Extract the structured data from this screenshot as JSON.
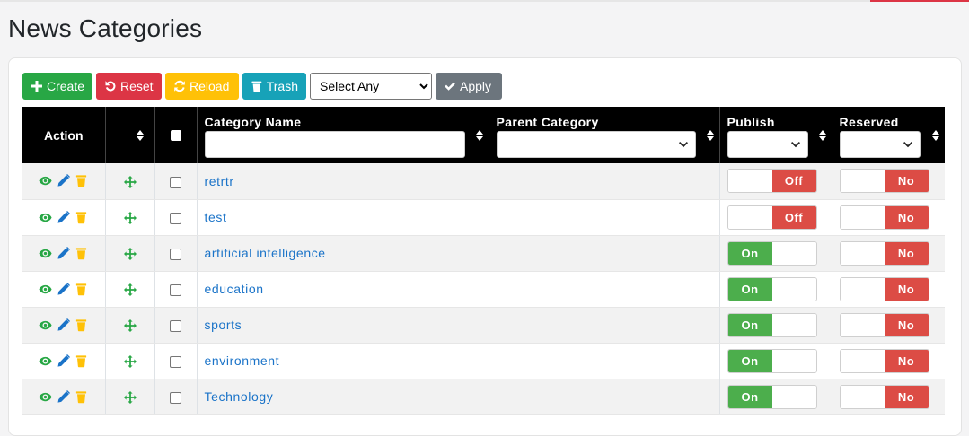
{
  "page": {
    "title": "News Categories"
  },
  "toolbar": {
    "create_label": "Create",
    "reset_label": "Reset",
    "reload_label": "Reload",
    "trash_label": "Trash",
    "bulk_select_value": "Select Any",
    "apply_label": "Apply"
  },
  "table": {
    "headers": {
      "action": "Action",
      "category_name": "Category Name",
      "parent_category": "Parent Category",
      "publish": "Publish",
      "reserved": "Reserved"
    },
    "rows": [
      {
        "name": "retrtr",
        "parent": "",
        "publish": "Off",
        "reserved": "No"
      },
      {
        "name": "test",
        "parent": "",
        "publish": "Off",
        "reserved": "No"
      },
      {
        "name": "artificial intelligence",
        "parent": "",
        "publish": "On",
        "reserved": "No"
      },
      {
        "name": "education",
        "parent": "",
        "publish": "On",
        "reserved": "No"
      },
      {
        "name": "sports",
        "parent": "",
        "publish": "On",
        "reserved": "No"
      },
      {
        "name": "environment",
        "parent": "",
        "publish": "On",
        "reserved": "No"
      },
      {
        "name": "Technology",
        "parent": "",
        "publish": "On",
        "reserved": "No"
      }
    ]
  },
  "icons": {
    "view": "eye-icon",
    "edit": "pencil-icon",
    "delete": "trash-icon",
    "move": "move-arrows-icon",
    "sort": "sort-icon",
    "dropdown": "chevron-down-icon"
  },
  "colors": {
    "create": "#28a745",
    "reset": "#dc3545",
    "reload": "#ffc107",
    "trash": "#17a2b8",
    "apply": "#6c757d",
    "on": "#4cae4c",
    "off": "#dc4c45",
    "link": "#1a73c8"
  }
}
